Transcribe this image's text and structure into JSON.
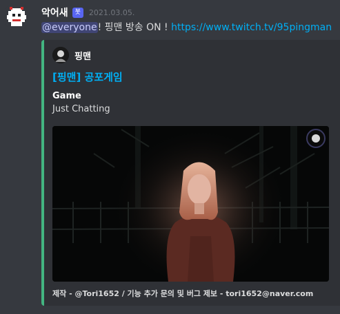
{
  "message": {
    "username": "악어새",
    "bot_tag": "봇",
    "timestamp": "2021.03.05.",
    "mention": "@everyone",
    "text": "! 핑맨 방송 ON ! ",
    "link": "https://www.twitch.tv/95pingman"
  },
  "embed": {
    "accent_color": "#43b581",
    "author": "핑맨",
    "title": "[핑맨] 공포게임",
    "field_name": "Game",
    "field_value": "Just Chatting",
    "footer": "제작 - @Tori1652 / 기능 추가 문의 및 버그 제보 - tori1652@naver.com",
    "image_icon": "stream-thumbnail"
  }
}
